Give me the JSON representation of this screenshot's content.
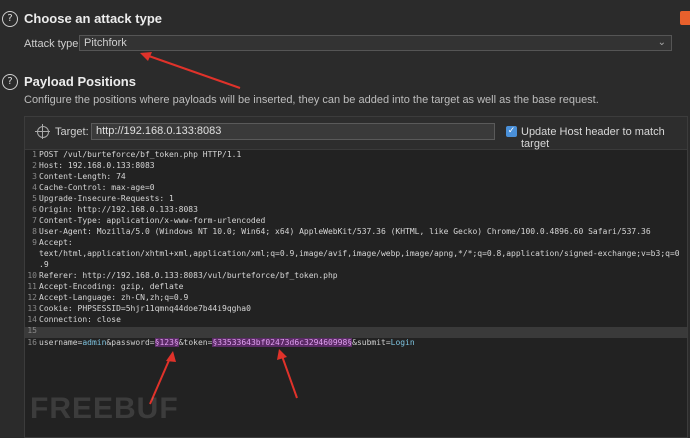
{
  "attack_section": {
    "title": "Choose an attack type",
    "attack_type_label": "Attack type:",
    "attack_type_value": "Pitchfork"
  },
  "payload_section": {
    "title": "Payload Positions",
    "description": "Configure the positions where payloads will be inserted, they can be added into the target as well as the base request."
  },
  "target": {
    "label": "Target:",
    "value": "http://192.168.0.133:8083",
    "update_host_label": "Update Host header to match target",
    "update_host_checked": true
  },
  "request_lines": [
    {
      "n": "1",
      "text": "POST /vul/burteforce/bf_token.php HTTP/1.1"
    },
    {
      "n": "2",
      "text": "Host: 192.168.0.133:8083"
    },
    {
      "n": "3",
      "text": "Content-Length: 74"
    },
    {
      "n": "4",
      "text": "Cache-Control: max-age=0"
    },
    {
      "n": "5",
      "text": "Upgrade-Insecure-Requests: 1"
    },
    {
      "n": "6",
      "text": "Origin: http://192.168.0.133:8083"
    },
    {
      "n": "7",
      "text": "Content-Type: application/x-www-form-urlencoded"
    },
    {
      "n": "8",
      "text": "User-Agent: Mozilla/5.0 (Windows NT 10.0; Win64; x64) AppleWebKit/537.36 (KHTML, like Gecko) Chrome/100.0.4896.60 Safari/537.36"
    },
    {
      "n": "9",
      "text": "Accept:"
    },
    {
      "n": "",
      "text": "text/html,application/xhtml+xml,application/xml;q=0.9,image/avif,image/webp,image/apng,*/*;q=0.8,application/signed-exchange;v=b3;q=0"
    },
    {
      "n": "",
      "text": ".9"
    },
    {
      "n": "10",
      "text": "Referer: http://192.168.0.133:8083/vul/burteforce/bf_token.php"
    },
    {
      "n": "11",
      "text": "Accept-Encoding: gzip, deflate"
    },
    {
      "n": "12",
      "text": "Accept-Language: zh-CN,zh;q=0.9"
    },
    {
      "n": "13",
      "text": "Cookie: PHPSESSID=5hjr11qmnq44doe7b44i9qgha0"
    },
    {
      "n": "14",
      "text": "Connection: close"
    },
    {
      "n": "15",
      "text": ""
    }
  ],
  "body_line": {
    "n": "16",
    "username_key": "username",
    "username_val": "admin",
    "password_key": "&password=",
    "password_marker": "§123§",
    "token_key": "&token=",
    "token_marker": "§33533643bf02473d6c329460998§",
    "submit_key": "&submit=",
    "submit_val": "Login"
  },
  "watermark": "FREEBUF",
  "colors": {
    "accent_orange": "#e8602c",
    "arrow_red": "#e0322a",
    "payload_marker": "#e0a0f0"
  }
}
